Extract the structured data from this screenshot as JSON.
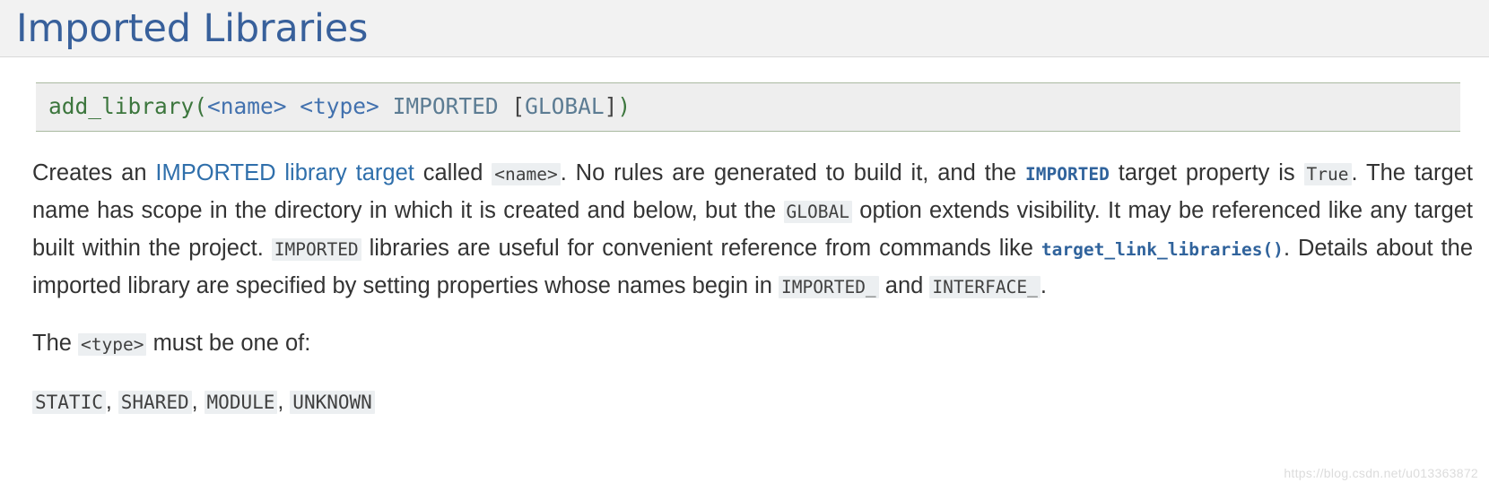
{
  "header": {
    "title": "Imported Libraries",
    "title_color": "#38609b",
    "background": "#f2f2f2"
  },
  "code_block": {
    "full_text": "add_library(<name> <type> IMPORTED [GLOBAL])",
    "tokens": {
      "function": "add_library(",
      "arg_name": "<name>",
      "space1": " ",
      "arg_type": "<type>",
      "space2": " ",
      "keyword_imported": "IMPORTED",
      "space3": " ",
      "bracket_open": "[",
      "keyword_global": "GLOBAL",
      "bracket_close": "]",
      "paren_close": ")"
    },
    "colors": {
      "function": "#3c763d",
      "argument": "#4271ae",
      "keyword": "#5c7c93",
      "punctuation": "#444444",
      "background": "#eeeeee",
      "border": "#a9b9a0"
    }
  },
  "paragraph_1": {
    "s1": "Creates an ",
    "link_text": "IMPORTED library target",
    "s2": " called ",
    "code_name": "<name>",
    "s3": ". No rules are generated to build it, and the ",
    "code_imported_link": "IMPORTED",
    "s4": " target property is ",
    "code_true": "True",
    "s5": ". The target name has scope in the directory in which it is created and below, but the ",
    "code_global": "GLOBAL",
    "s6": " option extends visibility. It may be referenced like any target built within the project. ",
    "code_imported": "IMPORTED",
    "s7": " libraries are useful for convenient reference from commands like ",
    "code_tll_link": "target_link_libraries()",
    "s8": ". Details about the imported library are specified by setting properties whose names begin in ",
    "code_imported_prefix": "IMPORTED_",
    "s9": " and ",
    "code_interface_prefix": "INTERFACE_",
    "s10": "."
  },
  "paragraph_2": {
    "s1": "The ",
    "code_type": "<type>",
    "s2": " must be one of:"
  },
  "type_list": {
    "items": [
      "STATIC",
      "SHARED",
      "MODULE",
      "UNKNOWN"
    ],
    "separator": ", "
  },
  "watermark": {
    "text": "https://blog.csdn.net/u013363872"
  }
}
